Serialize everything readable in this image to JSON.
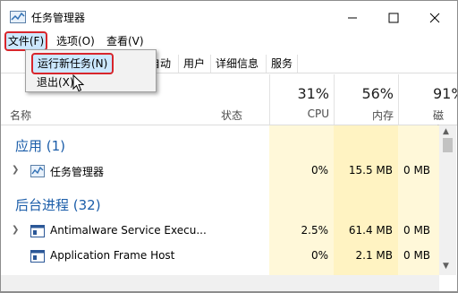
{
  "window": {
    "title": "任务管理器"
  },
  "menubar": {
    "file": "文件(F)",
    "options": "选项(O)",
    "view": "查看(V)"
  },
  "file_menu": {
    "run_new_task": "运行新任务(N)",
    "exit": "退出(X)"
  },
  "tabs": [
    "启动",
    "用户",
    "详细信息",
    "服务"
  ],
  "tabs_visible": [
    "自动",
    "用户",
    "详细信息",
    "服务"
  ],
  "columns": {
    "name": "名称",
    "status": "状态",
    "cpu": {
      "pct": "31%",
      "label": "CPU"
    },
    "memory": {
      "pct": "56%",
      "label": "内存"
    },
    "disk": {
      "pct": "91%",
      "label": "磁盘"
    }
  },
  "sections": {
    "apps": "应用 (1)",
    "background": "后台进程 (32)"
  },
  "rows": [
    {
      "name": "任务管理器",
      "cpu": "0%",
      "mem": "15.5 MB",
      "disk": "0 MB"
    },
    {
      "name": "Antimalware Service Execu...",
      "cpu": "2.5%",
      "mem": "61.4 MB",
      "disk": "0 MB"
    },
    {
      "name": "Application Frame Host",
      "cpu": "0%",
      "mem": "2.1 MB",
      "disk": "0 MB"
    }
  ],
  "colors": {
    "highlight_border": "#d8262c",
    "section_blue": "#1b5da9",
    "menu_hover": "#cce8ff"
  }
}
